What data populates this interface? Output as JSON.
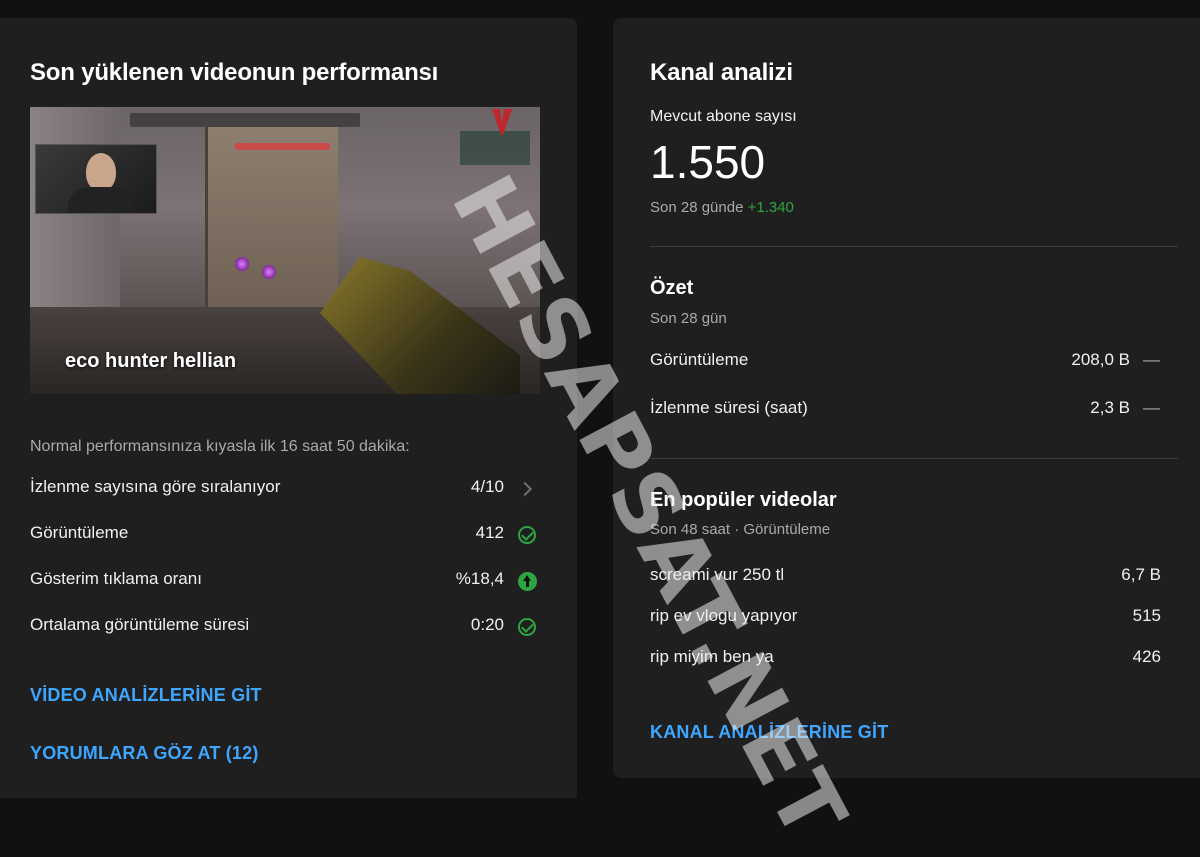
{
  "left_card": {
    "title": "Son yüklenen videonun performansı",
    "video": {
      "title": "eco hunter hellian"
    },
    "compare_note": "Normal performansınıza kıyasla ilk 16 saat 50 dakika:",
    "metrics": [
      {
        "label": "İzlenme sayısına göre sıralanıyor",
        "value": "4/10",
        "icon": "chevron-right-icon"
      },
      {
        "label": "Görüntüleme",
        "value": "412",
        "icon": "check-circle-icon"
      },
      {
        "label": "Gösterim tıklama oranı",
        "value": "%18,4",
        "icon": "arrow-up-circle-icon"
      },
      {
        "label": "Ortalama görüntüleme süresi",
        "value": "0:20",
        "icon": "check-circle-icon"
      }
    ],
    "links": {
      "video_analytics": "VİDEO ANALİZLERİNE GİT",
      "comments": "YORUMLARA GÖZ AT (12)"
    }
  },
  "right_card": {
    "title": "Kanal analizi",
    "subscribers": {
      "label": "Mevcut abone sayısı",
      "value": "1.550",
      "period": "Son 28 günde",
      "delta": "+1.340"
    },
    "summary": {
      "title": "Özet",
      "period": "Son 28 gün",
      "rows": [
        {
          "label": "Görüntüleme",
          "value": "208,0 B",
          "trend": "—"
        },
        {
          "label": "İzlenme süresi (saat)",
          "value": "2,3 B",
          "trend": "—"
        }
      ]
    },
    "top_videos": {
      "title": "En popüler videolar",
      "period": "Son 48 saat · Görüntüleme",
      "rows": [
        {
          "label": "screami vur 250 tl",
          "value": "6,7 B"
        },
        {
          "label": "rip ev vlogu yapıyor",
          "value": "515"
        },
        {
          "label": "rip miyim ben ya",
          "value": "426"
        }
      ]
    },
    "link": "KANAL ANALİZLERİNE GİT"
  },
  "watermark": "HESAPSAT.NET",
  "colors": {
    "background": "#111111",
    "card": "#1f1f1f",
    "link": "#3ea6ff",
    "positive": "#2ba640",
    "muted": "#aaaaaa"
  }
}
